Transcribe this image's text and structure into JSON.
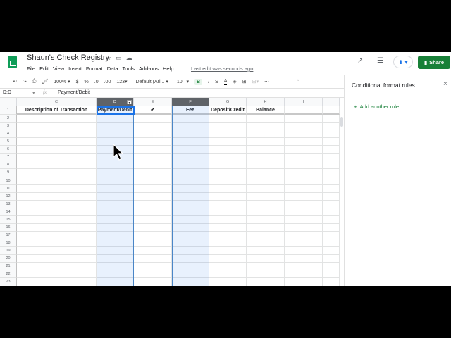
{
  "app": {
    "title": "Shaun's Check Registry",
    "last_edit": "Last edit was seconds ago",
    "share_label": "Share"
  },
  "menu": [
    "File",
    "Edit",
    "View",
    "Insert",
    "Format",
    "Data",
    "Tools",
    "Add-ons",
    "Help"
  ],
  "toolbar": {
    "zoom": "100%",
    "currency": "$",
    "percent": "%",
    "dec_less": ".0",
    "dec_more": ".00",
    "format": "123",
    "font": "Default (Ari...",
    "size": "10",
    "bold": "B",
    "italic": "I",
    "strike": "S",
    "textcolor": "A",
    "more": "⋯"
  },
  "formula_bar": {
    "name_box": "D:D",
    "fx": "fx",
    "value": "Payment/Debit"
  },
  "columns": [
    "C",
    "D",
    "E",
    "F",
    "G",
    "H",
    "I"
  ],
  "header_row": [
    "Description of Transaction",
    "Payment/Debit",
    "✔",
    "Fee",
    "Deposit/Credit",
    "Balance",
    ""
  ],
  "rows": [
    "1",
    "2",
    "3",
    "4",
    "5",
    "6",
    "7",
    "8",
    "9",
    "10",
    "11",
    "12",
    "13",
    "14",
    "15",
    "16",
    "17",
    "18",
    "19",
    "20",
    "21",
    "22",
    "23"
  ],
  "panel": {
    "title": "Conditional format rules",
    "add_rule": "Add another rule"
  },
  "colors": {
    "accent": "#188038",
    "selection": "#e8f0fe"
  }
}
